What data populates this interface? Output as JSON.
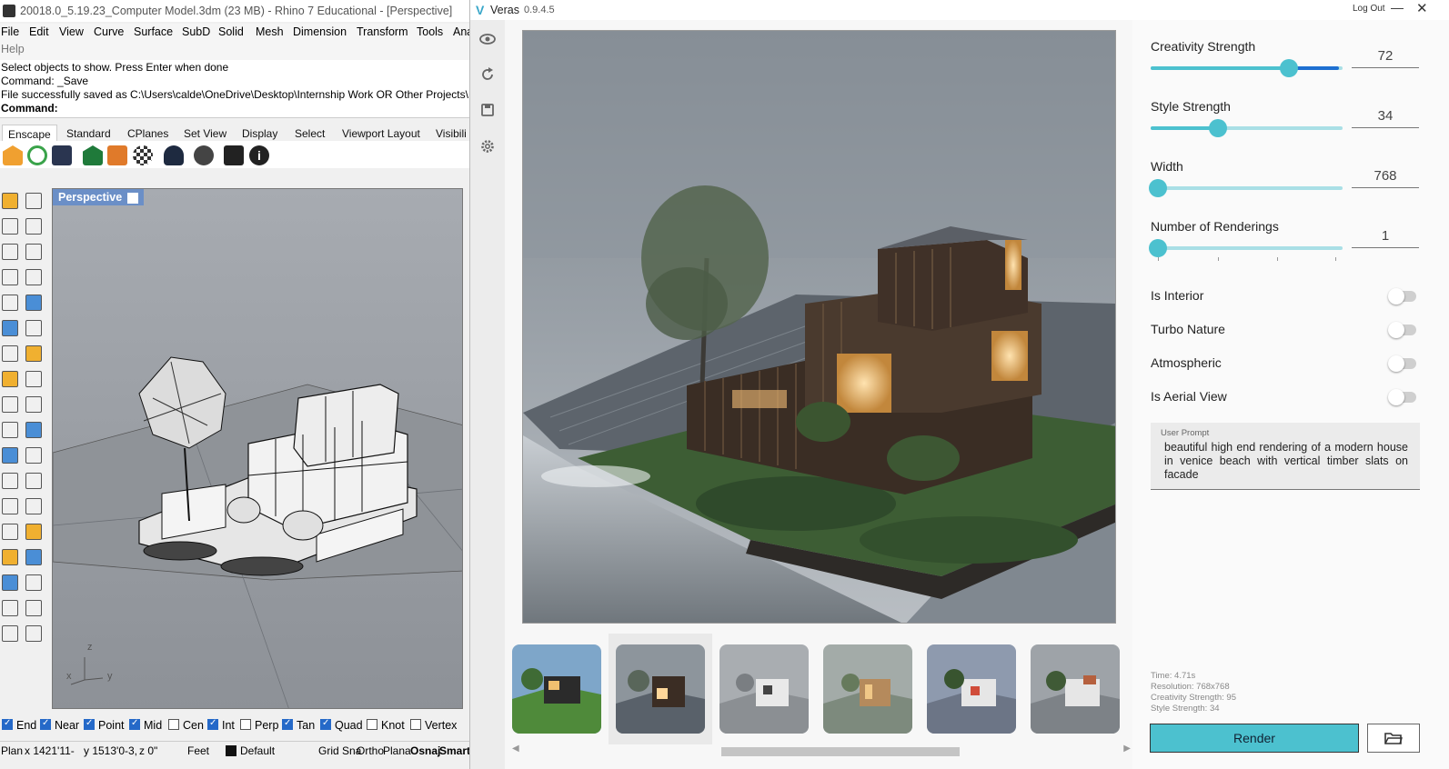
{
  "rhino": {
    "title": "20018.0_5.19.23_Computer Model.3dm (23 MB) - Rhino 7 Educational - [Perspective]",
    "menu": [
      "File",
      "Edit",
      "View",
      "Curve",
      "Surface",
      "SubD",
      "Solid",
      "Mesh",
      "Dimension",
      "Transform",
      "Tools",
      "Ana",
      "Help"
    ],
    "command_history": [
      "Select objects to show. Press Enter when done",
      "Command: _Save",
      "File successfully saved as C:\\Users\\calde\\OneDrive\\Desktop\\Internship Work OR Other Projects\\B+S"
    ],
    "command_prompt": "Command:",
    "tabs": [
      "Enscape",
      "Standard",
      "CPlanes",
      "Set View",
      "Display",
      "Select",
      "Viewport Layout",
      "Visibili"
    ],
    "viewport_label": "Perspective",
    "axis_labels": {
      "z": "z",
      "x": "x",
      "y": "y"
    },
    "osnaps": [
      {
        "label": "End",
        "checked": true
      },
      {
        "label": "Near",
        "checked": true
      },
      {
        "label": "Point",
        "checked": true
      },
      {
        "label": "Mid",
        "checked": true
      },
      {
        "label": "Cen",
        "checked": false
      },
      {
        "label": "Int",
        "checked": true
      },
      {
        "label": "Perp",
        "checked": false
      },
      {
        "label": "Tan",
        "checked": true
      },
      {
        "label": "Quad",
        "checked": true
      },
      {
        "label": "Knot",
        "checked": false
      },
      {
        "label": "Vertex",
        "checked": false
      }
    ],
    "status": {
      "plane": "Plan",
      "x": "x 1421'11-",
      "y": "y 1513'0-3,",
      "z": "z 0\"",
      "units": "Feet",
      "layer": "Default",
      "grid": "Grid Sna",
      "ortho": "Ortho",
      "planar": "Plana",
      "osnap": "Osnaj",
      "smart": "Smart"
    }
  },
  "veras": {
    "app_name": "Veras",
    "version": "0.9.4.5",
    "logout": "Log Out",
    "minimize": "—",
    "close": "✕",
    "sidebar_icons": [
      "eye-icon",
      "refresh-icon",
      "save-icon",
      "settings-icon"
    ],
    "sliders": [
      {
        "label": "Creativity Strength",
        "value": "72",
        "fraction": 0.72
      },
      {
        "label": "Style Strength",
        "value": "34",
        "fraction": 0.34
      },
      {
        "label": "Width",
        "value": "768",
        "fraction": 0.0
      },
      {
        "label": "Number of Renderings",
        "value": "1",
        "fraction": 0.0
      }
    ],
    "toggles": [
      {
        "label": "Is Interior",
        "on": false
      },
      {
        "label": "Turbo Nature",
        "on": false
      },
      {
        "label": "Atmospheric",
        "on": false
      },
      {
        "label": "Is Aerial View",
        "on": false
      }
    ],
    "prompt": {
      "label": "User Prompt",
      "text": "beautiful high end rendering of a modern house in venice beach with vertical timber slats on facade"
    },
    "render_info": [
      "Time: 4.71s",
      "Resolution: 768x768",
      "Creativity Strength: 95",
      "Style Strength: 34"
    ],
    "render_button": "Render",
    "folder_icon": "folder-open-icon",
    "thumbnail_count": 6,
    "selected_thumbnail": 2,
    "colors": {
      "accent": "#4cc1cf",
      "slider_secondary": "#1d6fd1",
      "viewport_label": "#6b8fc7"
    }
  }
}
